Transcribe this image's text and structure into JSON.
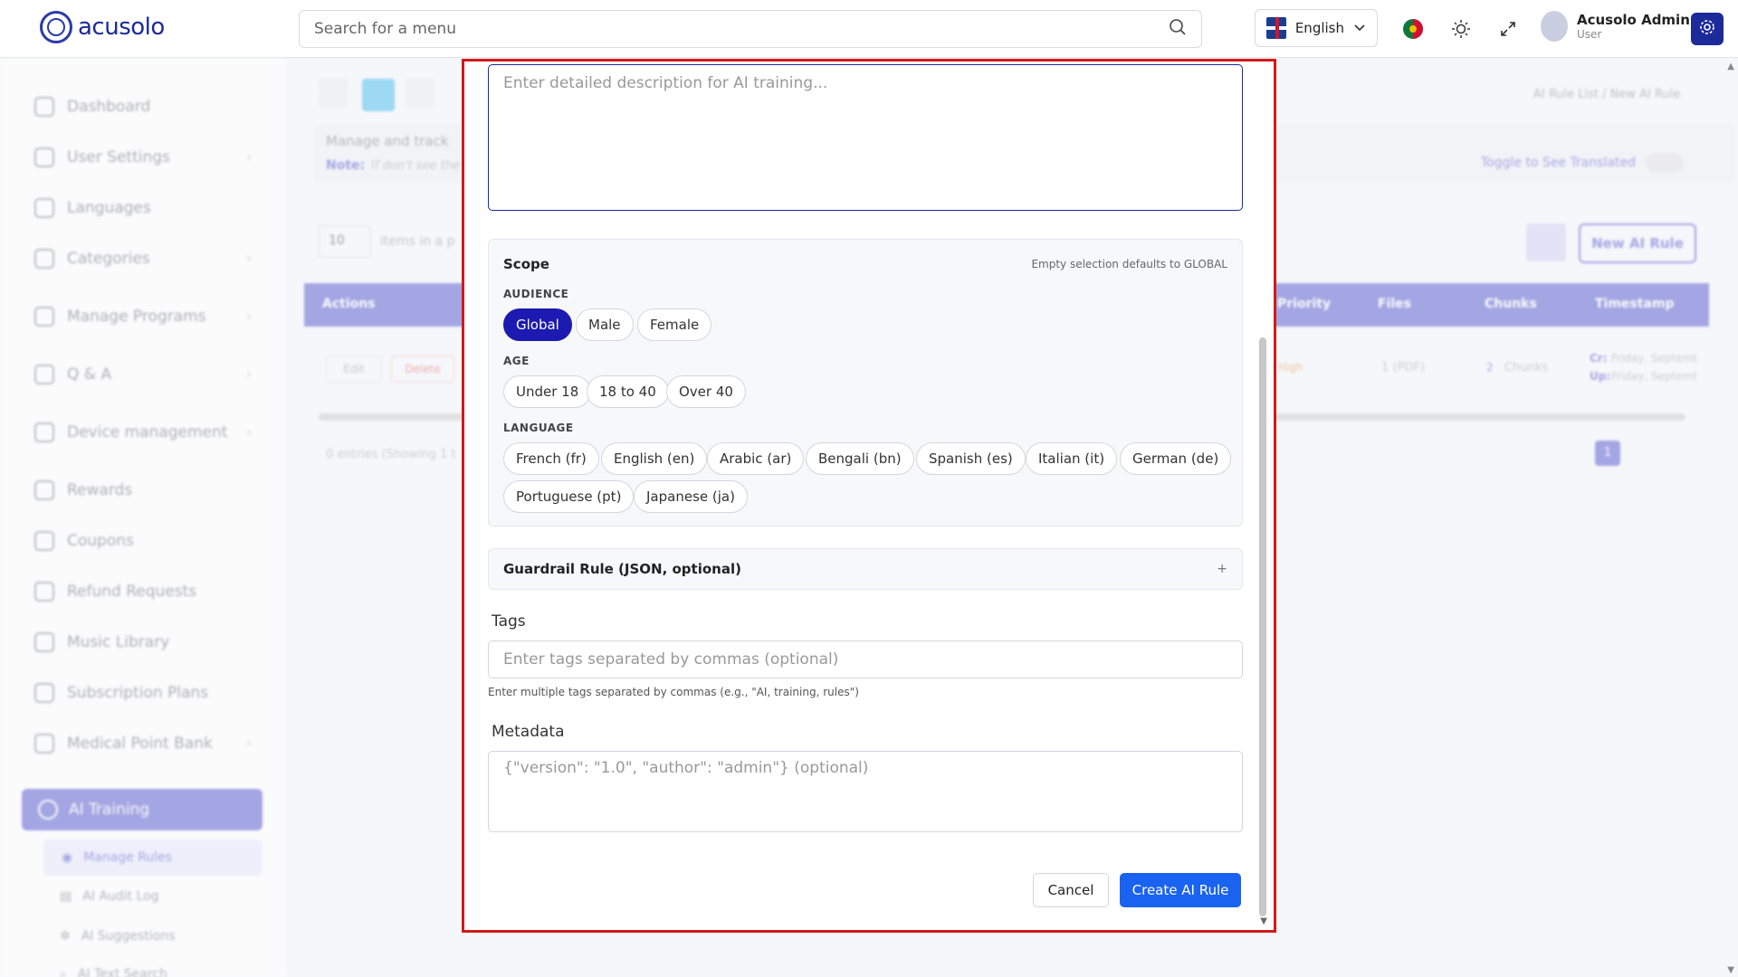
{
  "header": {
    "logo_text": "acusolo",
    "search_placeholder": "Search for a menu",
    "language": "English",
    "user_name": "Acusolo Admin",
    "user_role": "User"
  },
  "sidebar": {
    "items": [
      {
        "label": "Dashboard"
      },
      {
        "label": "User Settings"
      },
      {
        "label": "Languages"
      },
      {
        "label": "Categories"
      },
      {
        "label": "Manage Programs"
      },
      {
        "label": "Q & A"
      },
      {
        "label": "Device management"
      },
      {
        "label": "Rewards"
      },
      {
        "label": "Coupons"
      },
      {
        "label": "Refund Requests"
      },
      {
        "label": "Music Library"
      },
      {
        "label": "Subscription Plans"
      },
      {
        "label": "Medical Point Bank"
      }
    ],
    "active_group": "AI Training",
    "sub_items": [
      {
        "label": "Manage Rules"
      },
      {
        "label": "AI Audit Log"
      },
      {
        "label": "AI Suggestions"
      },
      {
        "label": "AI Text Search"
      }
    ]
  },
  "background": {
    "breadcrumb": "AI Rule List / New AI Rule",
    "manage_text": "Manage and track",
    "note_label": "Note:",
    "note_text": "If don't see the",
    "toggle_label": "Toggle to See Translated",
    "page_size": "10",
    "items_text": "items in a p",
    "new_rule_button": "New AI Rule",
    "columns": [
      "Actions",
      "Priority",
      "Files",
      "Chunks",
      "Timestamp"
    ],
    "row": {
      "edit": "Edit",
      "delete": "Delete",
      "priority": "High",
      "files": "1 (PDF)",
      "chunks": "Chunks",
      "chunks_count": "2",
      "cr_label": "Cr:",
      "cr_value": "Friday, Septemt",
      "up_label": "Up:",
      "up_value": "Friday, Septemt"
    },
    "entries_text": "0 entries (Showing 1 t",
    "current_page": "1"
  },
  "modal": {
    "description_placeholder": "Enter detailed description for AI training...",
    "scope": {
      "title": "Scope",
      "hint": "Empty selection defaults to GLOBAL",
      "audience_label": "AUDIENCE",
      "audience": [
        {
          "label": "Global",
          "selected": true
        },
        {
          "label": "Male",
          "selected": false
        },
        {
          "label": "Female",
          "selected": false
        }
      ],
      "age_label": "AGE",
      "age": [
        "Under 18",
        "18 to 40",
        "Over 40"
      ],
      "language_label": "LANGUAGE",
      "languages": [
        "French (fr)",
        "English (en)",
        "Arabic (ar)",
        "Bengali (bn)",
        "Spanish (es)",
        "Italian (it)",
        "German (de)",
        "Portuguese (pt)",
        "Japanese (ja)"
      ]
    },
    "guardrail_label": "Guardrail Rule (JSON, optional)",
    "guardrail_toggle": "+",
    "tags_label": "Tags",
    "tags_placeholder": "Enter tags separated by commas (optional)",
    "tags_help": "Enter multiple tags separated by commas (e.g., \"AI, training, rules\")",
    "metadata_label": "Metadata",
    "metadata_placeholder": "{\"version\": \"1.0\", \"author\": \"admin\"} (optional)",
    "cancel_button": "Cancel",
    "create_button": "Create AI Rule"
  },
  "colors": {
    "brand": "#1d2a9a",
    "primary_button": "#1a63f0",
    "selected_chip": "#1c1ab0",
    "highlight_border": "#d11a1a"
  }
}
